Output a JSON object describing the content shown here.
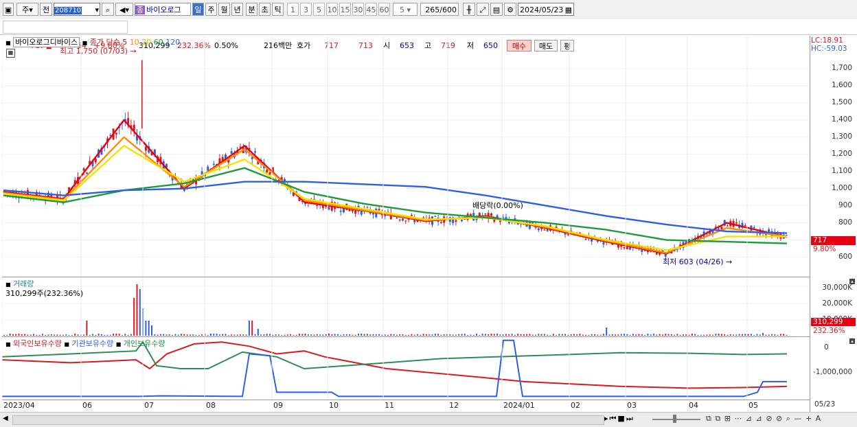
{
  "toolbar": {
    "period_btn": "주",
    "prev_label": "전",
    "code": "208710",
    "stock_name": "바이오로그",
    "stock_prefix": "종",
    "timeframes": [
      "일",
      "주",
      "월",
      "년",
      "분",
      "초",
      "틱"
    ],
    "tick_options": [
      "1",
      "3",
      "5",
      "10",
      "15",
      "30",
      "45",
      "60"
    ],
    "selected_count": "5",
    "count_value": "265",
    "count_total": "/600",
    "date": "2024/05/23"
  },
  "quote": {
    "price": "717",
    "arrow": "▲",
    "change": "64",
    "change_pct": "+9.80%",
    "volume": "310,299",
    "volume_pct": "232.36%",
    "turnover": "0.50%",
    "amount": "216백만",
    "bid_label": "호가",
    "bid1": "717",
    "bid2": "713",
    "open_label": "시",
    "open": "653",
    "high_label": "고",
    "high": "719",
    "low_label": "저",
    "low": "650",
    "buy_label": "매수",
    "sell_label": "매도",
    "avg_label": "평"
  },
  "price_panel": {
    "name": "바이오로그디바이스",
    "ma_label": "종가 단순",
    "ma_periods": [
      "5",
      "10",
      "20",
      "60",
      "120"
    ],
    "ma_colors": [
      "#e60012",
      "#ff8c00",
      "#f5e100",
      "#1e9a3c",
      "#2f5fe0"
    ],
    "high_marker": "최고 1,750 (07/03)",
    "low_marker": "최저 603 (04/26)",
    "dividend_label": "배당락(0.00%)",
    "lc_label": "LC:18.91",
    "hc_label": "HC:-59.03",
    "y_ticks": [
      "1,700",
      "1,600",
      "1,500",
      "1,400",
      "1,300",
      "1,200",
      "1,100",
      "1,000",
      "900",
      "800",
      "700",
      "600"
    ],
    "last_price_tag": "717",
    "last_pct_tag": "9.80%"
  },
  "volume_panel": {
    "title": "거래량",
    "sub": "310,299주(232.36%)",
    "y_ticks": [
      "30,000K",
      "20,000K",
      "10,000K"
    ],
    "last_tag": "310,299",
    "last_pct_tag": "232.36%"
  },
  "holding_panel": {
    "labels": [
      "외국인보유수량",
      "기관보유수량",
      "개인보유수량"
    ],
    "colors": [
      "#d71920",
      "#2f5fe0",
      "#1e8a4a"
    ],
    "y_ticks": [
      "0",
      "-1,000,000"
    ]
  },
  "x_axis": [
    "2023/04",
    "06",
    "07",
    "08",
    "09",
    "10",
    "11",
    "12",
    "2024/01",
    "02",
    "03",
    "04",
    "05",
    "05/23"
  ],
  "chart_data": {
    "type": "line",
    "title": "바이오로그디바이스",
    "x": [
      "2023/04",
      "06",
      "07",
      "08",
      "09",
      "10",
      "11",
      "12",
      "2024/01",
      "02",
      "03",
      "04",
      "05",
      "05/23"
    ],
    "ylim": [
      550,
      1780
    ],
    "series": [
      {
        "name": "5",
        "values": [
          980,
          940,
          1400,
          1000,
          1250,
          920,
          870,
          810,
          840,
          770,
          690,
          620,
          800,
          717
        ]
      },
      {
        "name": "10",
        "values": [
          975,
          935,
          1300,
          1010,
          1230,
          930,
          872,
          815,
          835,
          775,
          695,
          625,
          770,
          720
        ]
      },
      {
        "name": "20",
        "values": [
          970,
          930,
          1250,
          1040,
          1170,
          940,
          880,
          820,
          830,
          780,
          700,
          640,
          720,
          720
        ]
      },
      {
        "name": "60",
        "values": [
          960,
          920,
          990,
          1030,
          1120,
          980,
          910,
          860,
          830,
          800,
          760,
          700,
          690,
          680
        ]
      },
      {
        "name": "120",
        "values": [
          990,
          960,
          990,
          1000,
          1040,
          1040,
          1025,
          1010,
          960,
          900,
          840,
          790,
          750,
          740
        ]
      }
    ]
  }
}
